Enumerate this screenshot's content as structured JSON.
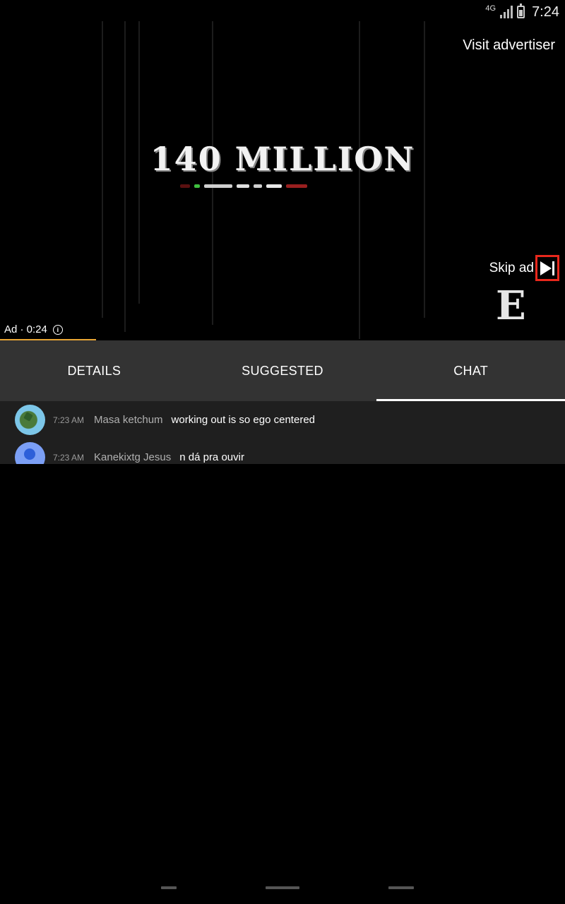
{
  "status_bar": {
    "network": "4G",
    "time": "7:24"
  },
  "ad": {
    "headline": "140 MILLION",
    "visit_advertiser": "Visit advertiser",
    "skip_label": "Skip ad",
    "skip_icon": "skip-next-icon",
    "countdown": "Ad · 0:24",
    "info_icon": "info-icon",
    "info_glyph": "i",
    "logo_letter": "E",
    "progress_fraction": 0.17,
    "accent_color": "#e8a534",
    "skip_highlight_color": "#e8281c"
  },
  "tabs": [
    {
      "label": "DETAILS",
      "active": false
    },
    {
      "label": "SUGGESTED",
      "active": false
    },
    {
      "label": "CHAT",
      "active": true
    }
  ],
  "chat": {
    "messages": [
      {
        "time": "7:23 AM",
        "author": "Masa ketchum",
        "text": "working out is so ego centered"
      },
      {
        "time": "7:23 AM",
        "author": "Kanekixtg Jesus",
        "text": "n dá pra ouvir"
      }
    ]
  }
}
